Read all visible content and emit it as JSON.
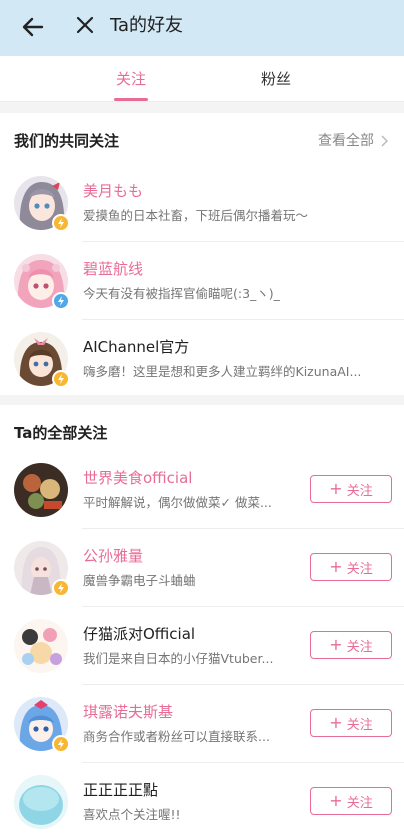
{
  "header": {
    "title": "Ta的好友",
    "back_icon": "arrow-left-icon",
    "close_icon": "close-icon",
    "background": "#d2e8f5"
  },
  "tabs": [
    {
      "label": "关注",
      "active": true
    },
    {
      "label": "粉丝",
      "active": false
    }
  ],
  "accent_color": "#e86d96",
  "mutual_section": {
    "title": "我们的共同关注",
    "view_all": "查看全部",
    "items": [
      {
        "name": "美月もも",
        "desc": "爱摸鱼的日本社畜，下班后偶尔播着玩～",
        "name_style": "pink",
        "badge": "yellow"
      },
      {
        "name": "碧蓝航线",
        "desc": "今天有没有被指挥官偷瞄呢(:3_ヽ)_",
        "name_style": "pink",
        "badge": "blue"
      },
      {
        "name": "AIChannel官方",
        "desc": "嗨多磨！这里是想和更多人建立羁绊的KizunaAI...",
        "name_style": "dark",
        "badge": "yellow"
      }
    ]
  },
  "all_section": {
    "title": "Ta的全部关注",
    "follow_label": "关注",
    "items": [
      {
        "name": "世界美食official",
        "desc": "平时解解说，偶尔做做菜✓ 做菜...",
        "name_style": "pink",
        "badge": "none"
      },
      {
        "name": "公孙雅量",
        "desc": "魔兽争霸电子斗蛐蛐",
        "name_style": "pink",
        "badge": "yellow"
      },
      {
        "name": "仔猫派对Official",
        "desc": "我们是来自日本的小仔猫Vtuber...",
        "name_style": "dark",
        "badge": "none"
      },
      {
        "name": "琪露诺夫斯基",
        "desc": "商务合作或者粉丝可以直接联系...",
        "name_style": "pink",
        "badge": "yellow"
      },
      {
        "name": "正正正正點",
        "desc": "喜欢点个关注喔!!",
        "name_style": "dark",
        "badge": "none"
      }
    ]
  }
}
